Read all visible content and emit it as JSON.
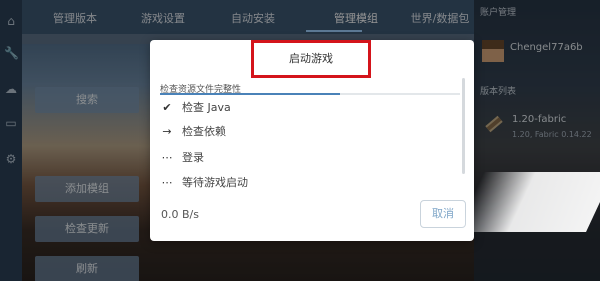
{
  "tabs": [
    {
      "label": "管理版本"
    },
    {
      "label": "游戏设置"
    },
    {
      "label": "自动安装"
    },
    {
      "label": "管理模组"
    },
    {
      "label": "世界/数据包"
    }
  ],
  "active_tab": "管理模组",
  "sidebar_buttons": {
    "search": "搜索",
    "add_mod": "添加模组",
    "check_update": "检查更新",
    "refresh": "刷新"
  },
  "right_panel": {
    "account_title": "账户管理",
    "username": "Chengel77a6b",
    "version_section": "版本列表",
    "version_name": "1.20-fabric",
    "version_sub": "1.20, Fabric 0.14.22"
  },
  "dialog": {
    "title": "启动游戏",
    "progress_label": "检查资源文件完整性",
    "progress": 0.6,
    "steps": [
      {
        "icon": "check-icon",
        "label": "检查 Java"
      },
      {
        "icon": "arrow-right-icon",
        "label": "检查依赖"
      },
      {
        "icon": "ellipsis-icon",
        "label": "登录"
      },
      {
        "icon": "ellipsis-icon",
        "label": "等待游戏启动"
      }
    ],
    "speed": "0.0 B/s",
    "cancel_label": "取消"
  },
  "colors": {
    "highlight": "#d4141b",
    "progress": "#4a82b8",
    "accent": "#7fa6c8"
  }
}
